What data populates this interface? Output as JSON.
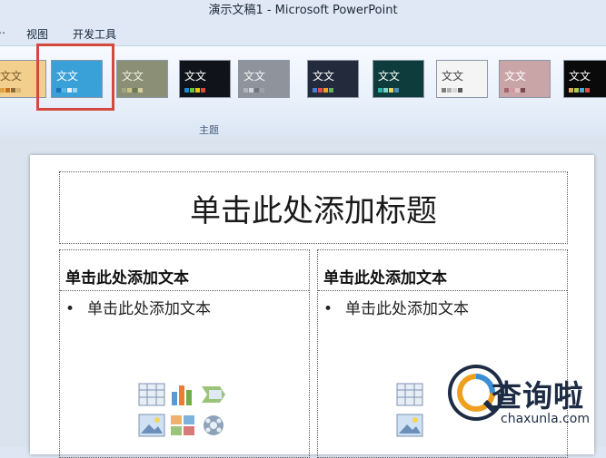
{
  "window": {
    "title": "演示文稿1 - Microsoft PowerPoint"
  },
  "menu": {
    "view": "视图",
    "developer": "开发工具"
  },
  "ribbon": {
    "group_label": "主题",
    "themes": [
      {
        "label": "文文",
        "bg": "#f2cf8c",
        "fg": "#7a5a2a",
        "swatches": [
          "#e0a040",
          "#c86f1e",
          "#8c6b3a",
          "#d9b36e"
        ]
      },
      {
        "label": "文文",
        "bg": "#3aa0d8",
        "fg": "#ffffff",
        "swatches": [
          "#1d71b8",
          "#51b8e6",
          "#f0f0f0",
          "#9bd3f0"
        ]
      },
      {
        "label": "文文",
        "bg": "#8b8f75",
        "fg": "#f1f1e5",
        "swatches": [
          "#a0a67d",
          "#c9c38a",
          "#6b7a52",
          "#d6cfa0"
        ]
      },
      {
        "label": "文文",
        "bg": "#10141a",
        "fg": "#ffffff",
        "swatches": [
          "#1b87d6",
          "#6fbf3f",
          "#e8c21b",
          "#d84a3a"
        ]
      },
      {
        "label": "文文",
        "bg": "#8f949c",
        "fg": "#f5f5f5",
        "swatches": [
          "#b0b6bf",
          "#d0d4da",
          "#6f7680",
          "#9aa1aa"
        ]
      },
      {
        "label": "文文",
        "bg": "#232a3b",
        "fg": "#ffffff",
        "swatches": [
          "#4c7bd6",
          "#e34c4c",
          "#f0a020",
          "#68b05a"
        ]
      },
      {
        "label": "文文",
        "bg": "#0e3c3d",
        "fg": "#ffffff",
        "swatches": [
          "#2ab3a6",
          "#7bd1c6",
          "#e6d46a",
          "#4c8fb8"
        ]
      },
      {
        "label": "文文",
        "bg": "#f4f4f4",
        "fg": "#444444",
        "swatches": [
          "#7e7e7e",
          "#b0b0b0",
          "#d6d6d6",
          "#5a5a5a"
        ]
      },
      {
        "label": "文文",
        "bg": "#c9a5a8",
        "fg": "#ffffff",
        "swatches": [
          "#a26670",
          "#d49aa2",
          "#e6c3c6",
          "#7a4a52"
        ]
      },
      {
        "label": "文文",
        "bg": "#0a0a0a",
        "fg": "#ffffff",
        "swatches": [
          "#d9b04a",
          "#b1c94c",
          "#4ca8d9",
          "#d94c4c"
        ]
      }
    ]
  },
  "slide": {
    "title": "单击此处添加标题",
    "left": {
      "heading": "单击此处添加文本",
      "bullet": "单击此处添加文本"
    },
    "right": {
      "heading": "单击此处添加文本",
      "bullet": "单击此处添加文本"
    }
  },
  "placeholder_icons": [
    "table-icon",
    "chart-icon",
    "smartart-icon",
    "picture-icon",
    "clipart-icon",
    "media-icon"
  ],
  "watermark": {
    "cn": "查询啦",
    "domain": "chaxunla.com"
  }
}
